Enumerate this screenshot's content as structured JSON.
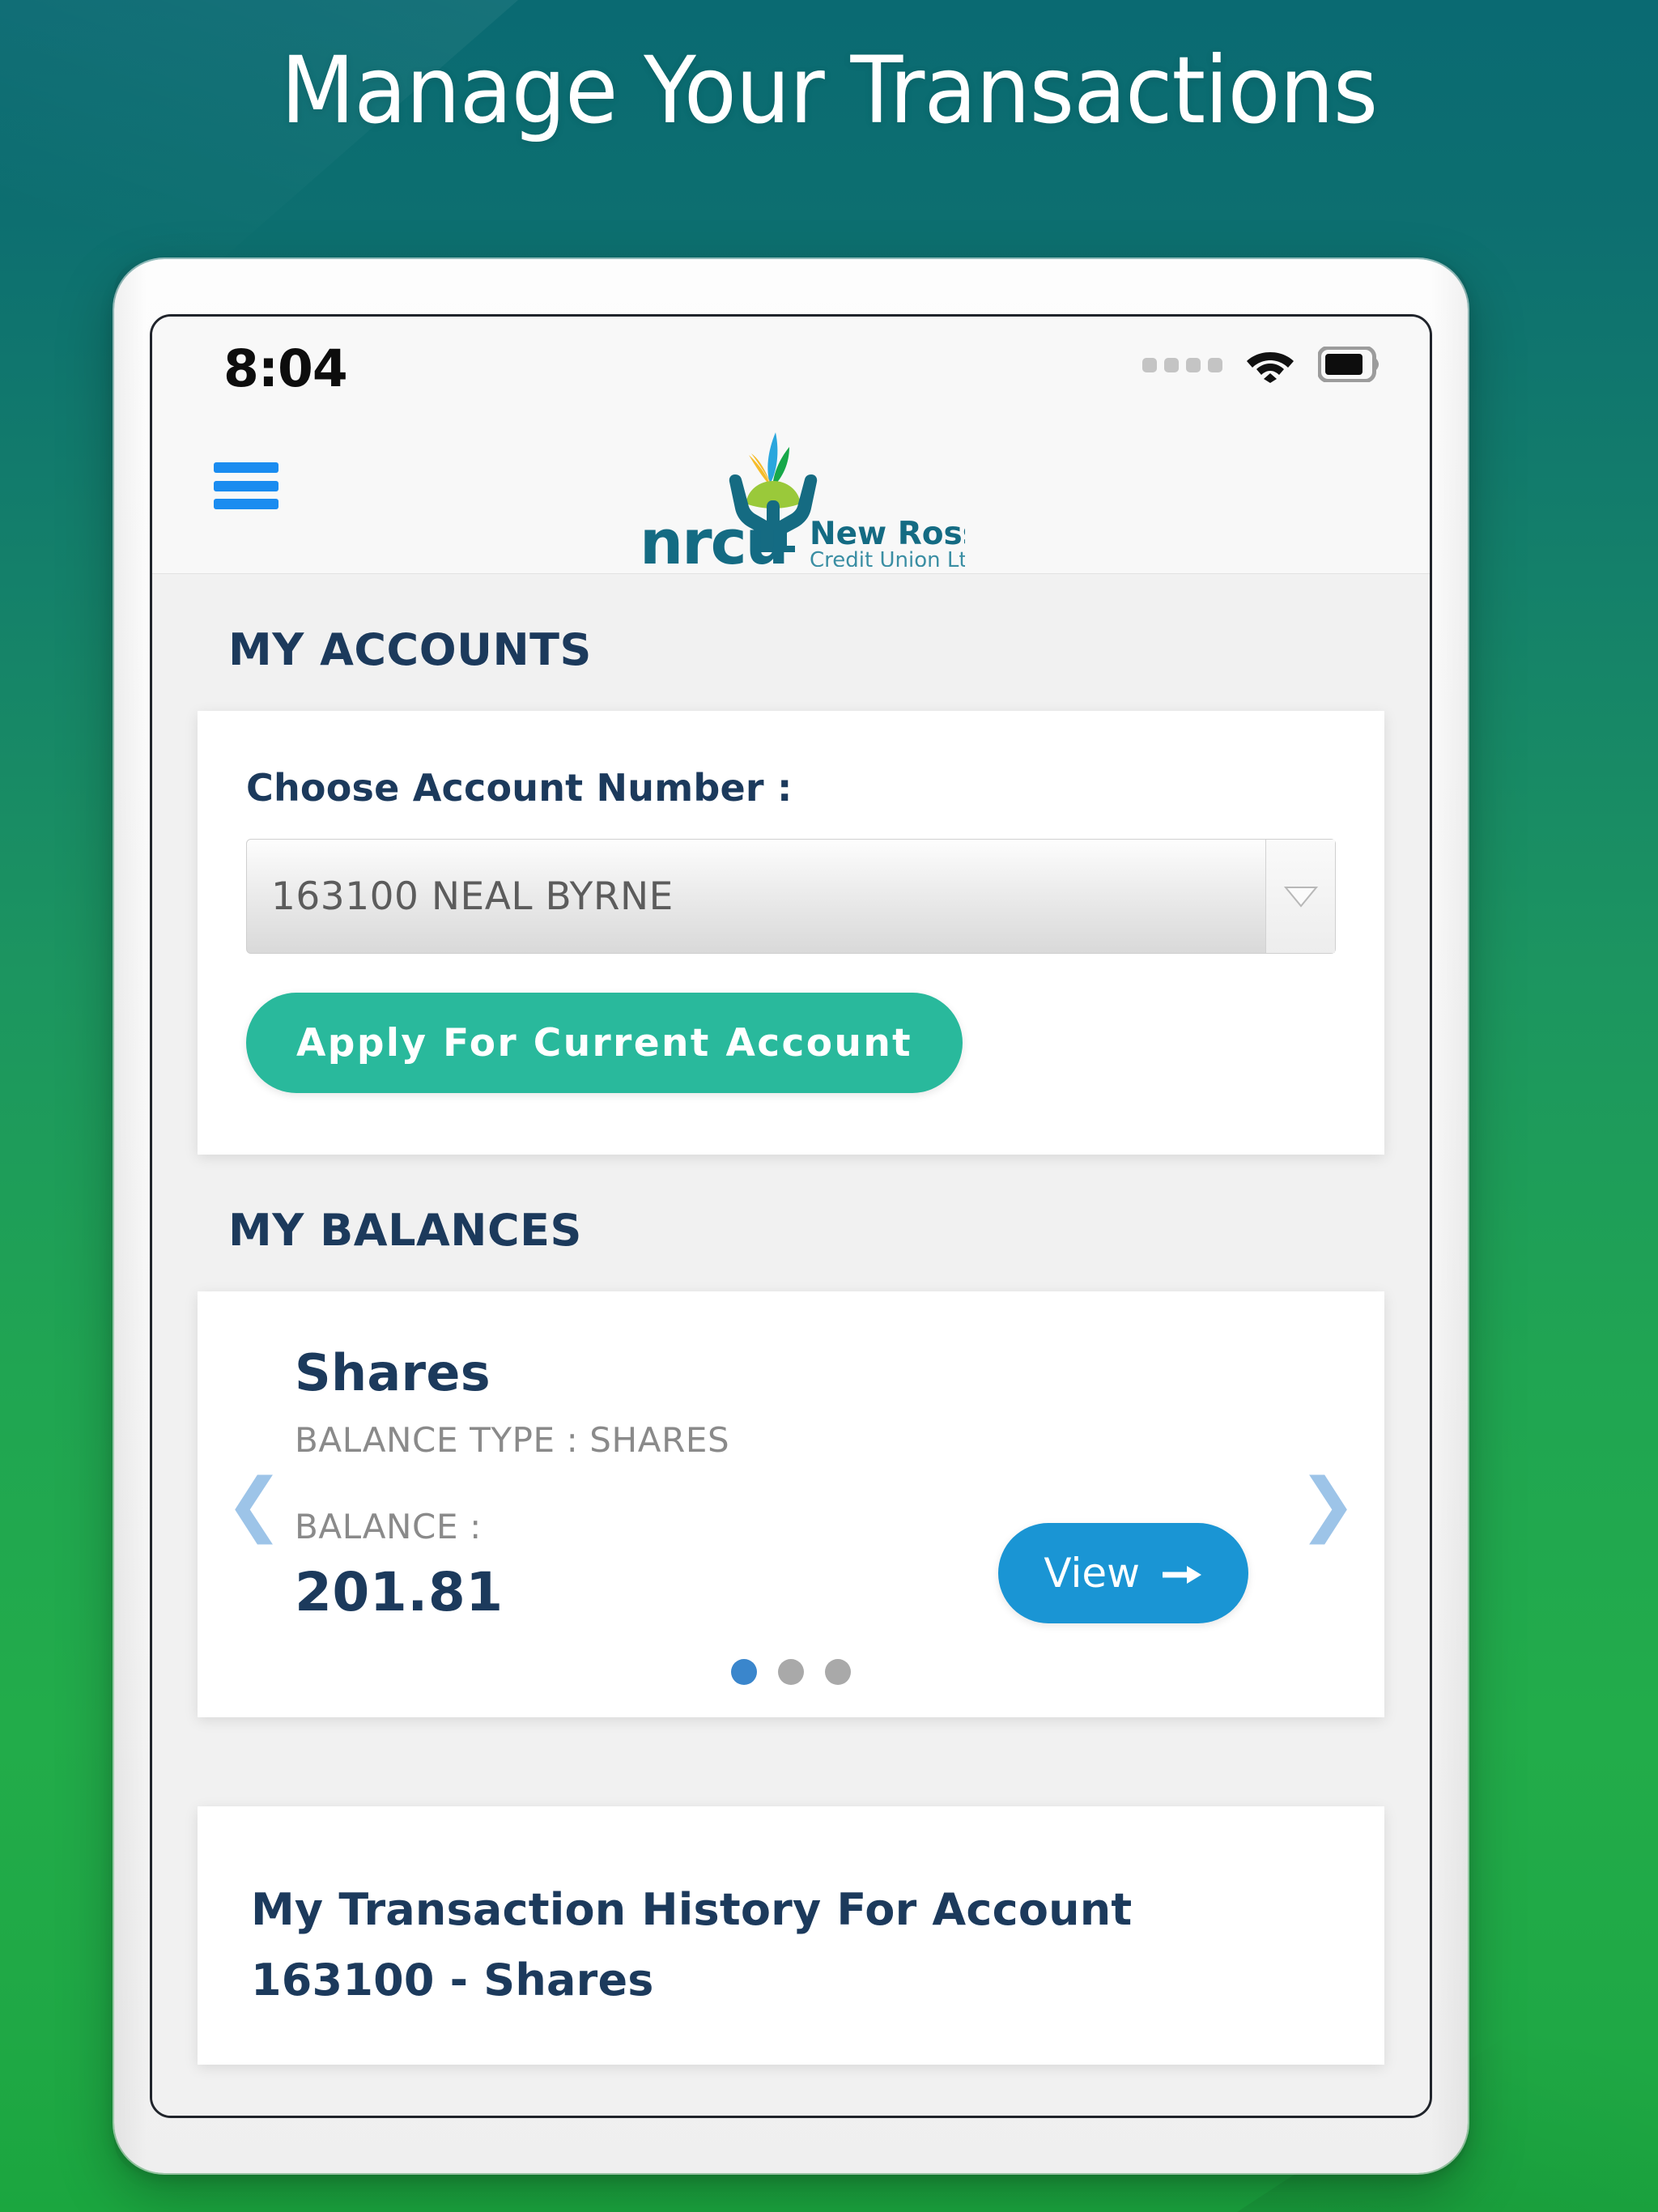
{
  "promo": {
    "headline": "Manage Your Transactions"
  },
  "device": {
    "camera_icon": "camera-dot",
    "sensor_icon": "sensor-dot"
  },
  "statusbar": {
    "time": "8:04",
    "signal_icon": "signal-dots-icon",
    "wifi_icon": "wifi-icon",
    "battery_icon": "battery-icon"
  },
  "appbar": {
    "menu_icon": "hamburger-menu-icon",
    "logo": {
      "mark": "nrcu-hands-plant-logo",
      "wordmark": "nrcu",
      "name_line1": "New Ross",
      "name_line2": "Credit Union Ltd"
    },
    "notification_glyph": ")"
  },
  "accounts": {
    "section_title": "MY ACCOUNTS",
    "choose_label": "Choose Account Number :",
    "selected_account": "163100 NEAL BYRNE",
    "dropdown_icon": "chevron-down-icon",
    "apply_button": "Apply For Current Account"
  },
  "balances": {
    "section_title": "MY BALANCES",
    "card": {
      "title": "Shares",
      "type_line": "BALANCE TYPE : SHARES",
      "balance_label": "BALANCE :",
      "balance_value": "201.81",
      "view_button": "View",
      "view_arrow_icon": "arrow-right-icon"
    },
    "prev_icon": "chevron-left-icon",
    "next_icon": "chevron-right-icon",
    "dots_total": 3,
    "dots_active_index": 0
  },
  "transactions": {
    "title": "My Transaction History For Account 163100 - Shares"
  },
  "colors": {
    "bg_top": "#0a6a72",
    "bg_bottom": "#1ba63f",
    "navy": "#1c3a5c",
    "teal_button": "#29b99c",
    "blue_button": "#1a95d4",
    "menu_blue": "#1a8cf0",
    "dot_active": "#3a86cc",
    "dot_inactive": "#a9a9a9",
    "muted_text": "#8a8a8a"
  }
}
